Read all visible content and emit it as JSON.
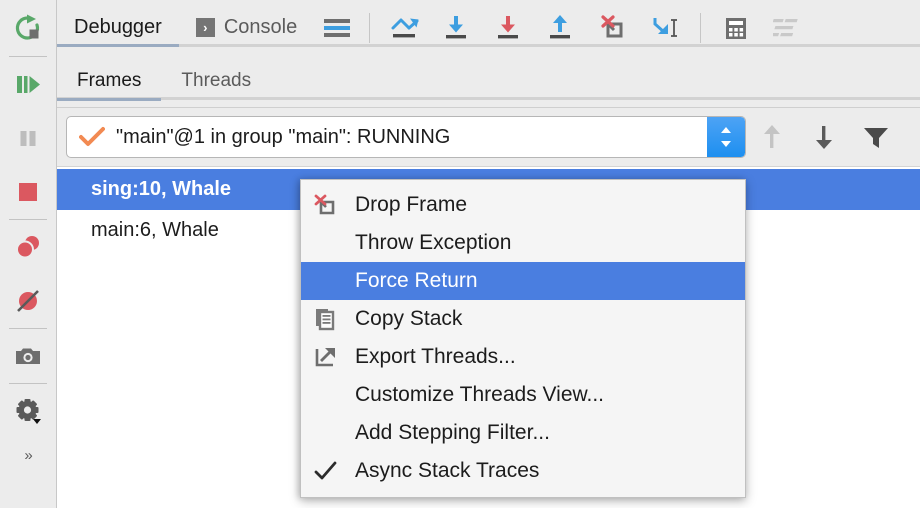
{
  "left_toolbar": {
    "buttons": [
      {
        "name": "rerun-button",
        "icon": "rerun-icon",
        "tooltip": "Rerun"
      },
      {
        "name": "resume-program-button",
        "icon": "resume-program-icon",
        "tooltip": "Resume Program"
      },
      {
        "name": "pause-program-button",
        "icon": "pause-program-icon",
        "tooltip": "Pause Program"
      },
      {
        "name": "stop-button",
        "icon": "stop-icon",
        "tooltip": "Stop"
      },
      {
        "name": "view-breakpoints-button",
        "icon": "view-breakpoints-icon",
        "tooltip": "View Breakpoints"
      },
      {
        "name": "mute-breakpoints-button",
        "icon": "mute-breakpoints-icon",
        "tooltip": "Mute Breakpoints"
      },
      {
        "name": "thread-dump-button",
        "icon": "camera-icon",
        "tooltip": "Get Thread Dump"
      },
      {
        "name": "settings-button",
        "icon": "gear-icon",
        "tooltip": "Settings"
      }
    ],
    "expand_label": "»"
  },
  "tabs": {
    "items": [
      {
        "label": "Debugger",
        "selected": true,
        "icon": null
      },
      {
        "label": "Console",
        "selected": false,
        "icon": "console-icon"
      }
    ]
  },
  "toolbar": {
    "buttons": [
      {
        "name": "layout-settings-button",
        "icon": "layout-icon"
      },
      {
        "name": "show-execution-point-button",
        "icon": "show-execution-point-icon"
      },
      {
        "name": "step-over-button",
        "icon": "step-over-icon"
      },
      {
        "name": "step-into-button",
        "icon": "step-into-icon"
      },
      {
        "name": "step-out-button",
        "icon": "step-out-icon"
      },
      {
        "name": "drop-frame-button",
        "icon": "drop-frame-icon"
      },
      {
        "name": "run-to-cursor-button",
        "icon": "run-to-cursor-icon"
      },
      {
        "name": "evaluate-expression-button",
        "icon": "calculator-icon"
      },
      {
        "name": "settings-list-button",
        "icon": "settings-list-icon"
      }
    ]
  },
  "subtabs": {
    "items": [
      {
        "label": "Frames",
        "selected": true
      },
      {
        "label": "Threads",
        "selected": false
      }
    ]
  },
  "thread_selector": {
    "value": "\"main\"@1 in group \"main\": RUNNING",
    "status_icon": "check-icon",
    "status_color": "#f28a52",
    "stepper_icon": "stepper-up-down-icon",
    "stepper_color": "#2e96f0",
    "actions": [
      {
        "name": "move-up-button",
        "icon": "arrow-up-icon",
        "enabled": false
      },
      {
        "name": "move-down-button",
        "icon": "arrow-down-icon",
        "enabled": true
      },
      {
        "name": "filter-button",
        "icon": "funnel-icon",
        "enabled": true
      }
    ]
  },
  "frames": {
    "rows": [
      {
        "label": "sing:10, Whale",
        "selected": true
      },
      {
        "label": "main:6, Whale",
        "selected": false
      }
    ],
    "selection_color": "#4a7ee0"
  },
  "context_menu": {
    "items": [
      {
        "label": "Drop Frame",
        "icon": "drop-frame-icon",
        "selected": false,
        "checked": false
      },
      {
        "label": "Throw Exception",
        "icon": null,
        "selected": false,
        "checked": false
      },
      {
        "label": "Force Return",
        "icon": null,
        "selected": true,
        "checked": false
      },
      {
        "label": "Copy Stack",
        "icon": "copy-stack-icon",
        "selected": false,
        "checked": false
      },
      {
        "label": "Export Threads...",
        "icon": "export-threads-icon",
        "selected": false,
        "checked": false
      },
      {
        "label": "Customize Threads View...",
        "icon": null,
        "selected": false,
        "checked": false
      },
      {
        "label": "Add Stepping Filter...",
        "icon": null,
        "selected": false,
        "checked": false
      },
      {
        "label": "Async Stack Traces",
        "icon": "check-icon",
        "selected": false,
        "checked": true
      }
    ],
    "highlight_color": "#4a7ee0"
  }
}
